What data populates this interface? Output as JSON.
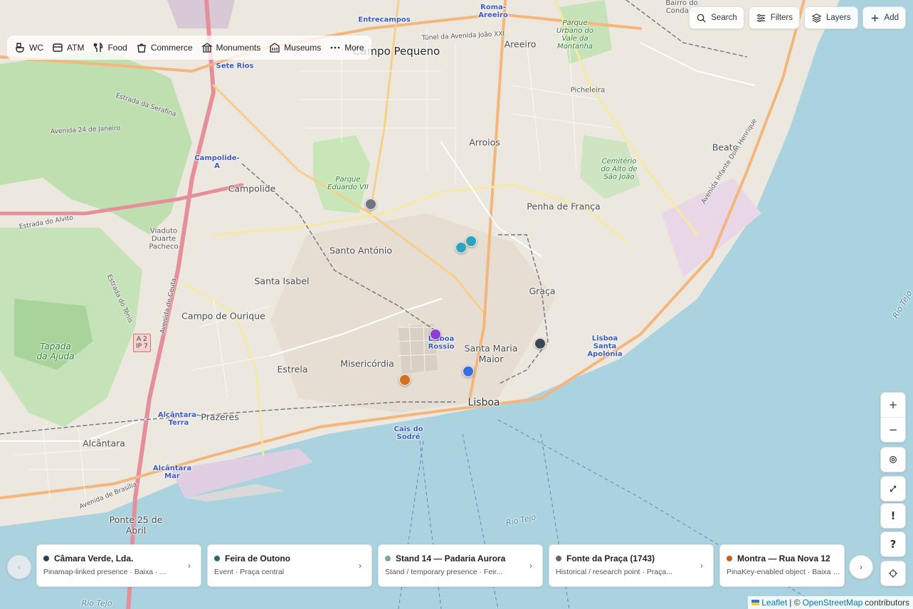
{
  "categories": [
    {
      "label": "WC",
      "icon": "wc-icon"
    },
    {
      "label": "ATM",
      "icon": "atm-icon"
    },
    {
      "label": "Food",
      "icon": "food-icon"
    },
    {
      "label": "Commerce",
      "icon": "commerce-icon"
    },
    {
      "label": "Monuments",
      "icon": "monuments-icon"
    },
    {
      "label": "Museums",
      "icon": "museums-icon"
    },
    {
      "label": "More",
      "icon": "more-icon"
    }
  ],
  "top_buttons": {
    "search": "Search",
    "filters": "Filters",
    "layers": "Layers",
    "add": "Add"
  },
  "map_controls": {
    "zoom_in": "+",
    "zoom_out": "−",
    "help": "?",
    "alert": "!"
  },
  "map_labels": {
    "campo_pequeno": "Campo Pequeno",
    "areeiro": "Areeiro",
    "arroios": "Arroios",
    "penha": "Penha de França",
    "campolide": "Campolide",
    "santo_antonio": "Santo António",
    "santa_isabel": "Santa Isabel",
    "graca": "Graça",
    "campo_ourique": "Campo de Ourique",
    "estrela": "Estrela",
    "misericordia": "Misericórdia",
    "santa_maria": "Santa Maria Maior",
    "lisboa": "Lisboa",
    "prazeres": "Prazeres",
    "alcantara": "Alcântara",
    "beato": "Beato",
    "ponte": "Ponte 25 de Abril",
    "rio_tejo": "Rio Tejo",
    "rio_tejo2": "Rio Tejo",
    "rio_tejo3": "Rio Tejo",
    "entrecampos": "Entrecampos",
    "roma_areeiro": "Roma-Areeiro",
    "sete_rios": "Sete Rios",
    "campolide_a": "Campolide-A",
    "rossio": "Lisboa Rossio",
    "cais_sodre": "Cais do Sodré",
    "santa_apolonia": "Lisboa Santa Apolónia",
    "alcantara_terra": "Alcântara-Terra",
    "alcantara_mar": "Alcântara Mar",
    "parque_eduardo": "Parque Eduardo VII",
    "tapada": "Tapada da Ajuda",
    "parque_urbano": "Parque Urbano do Vale da Montanha",
    "cemiterio": "Cemitério do Alto de São João",
    "picheleira": "Picheleira",
    "bairro_condado": "Bairro do Condado",
    "av_24_jan": "Avenida 24 de Janeiro",
    "estrada_serafina": "Estrada da Serafina",
    "tunel": "Túnel da Avenida João XXI",
    "viaduto": "Viaduto Duarte Pacheco",
    "estrada_alvito": "Estrada do Alvito",
    "av_brasilia": "Avenida de Brasília",
    "av_infante": "Avenida Infante Dom Henrique",
    "estrada_tenis": "Estrada do Ténis",
    "av_ceuta": "Avenida de Ceuta",
    "shield_a2": "A 2",
    "shield_ip7": "IP 7"
  },
  "markers_colors": {
    "gray": "#6f7480",
    "teal": "#2fa3bd",
    "purple": "#8a3fd6",
    "blue": "#3a6fe0",
    "dark": "#3d4452",
    "orange": "#d2721f"
  },
  "cards": [
    {
      "title": "Câmara Verde, Lda.",
      "subtitle": "Pinamap-linked presence · Baixa · ...",
      "dot": "#2b3e66"
    },
    {
      "title": "Feira de Outono",
      "subtitle": "Event · Praça central",
      "dot": "#2e6e5b"
    },
    {
      "title": "Stand 14 — Padaria Aurora",
      "subtitle": "Stand / temporary presence · Feir...",
      "dot": "#7aa89a"
    },
    {
      "title": "Fonte da Praça (1743)",
      "subtitle": "Historical / research point · Praça...",
      "dot": "#666a70"
    },
    {
      "title": "Montra — Rua Nova 12",
      "subtitle": "PinaKey-enabled object · Baixa · c...",
      "dot": "#c8601a"
    }
  ],
  "attribution": {
    "leaflet": "Leaflet",
    "sep": "| ©",
    "osm": "OpenStreetMap",
    "contrib": "contributors"
  }
}
